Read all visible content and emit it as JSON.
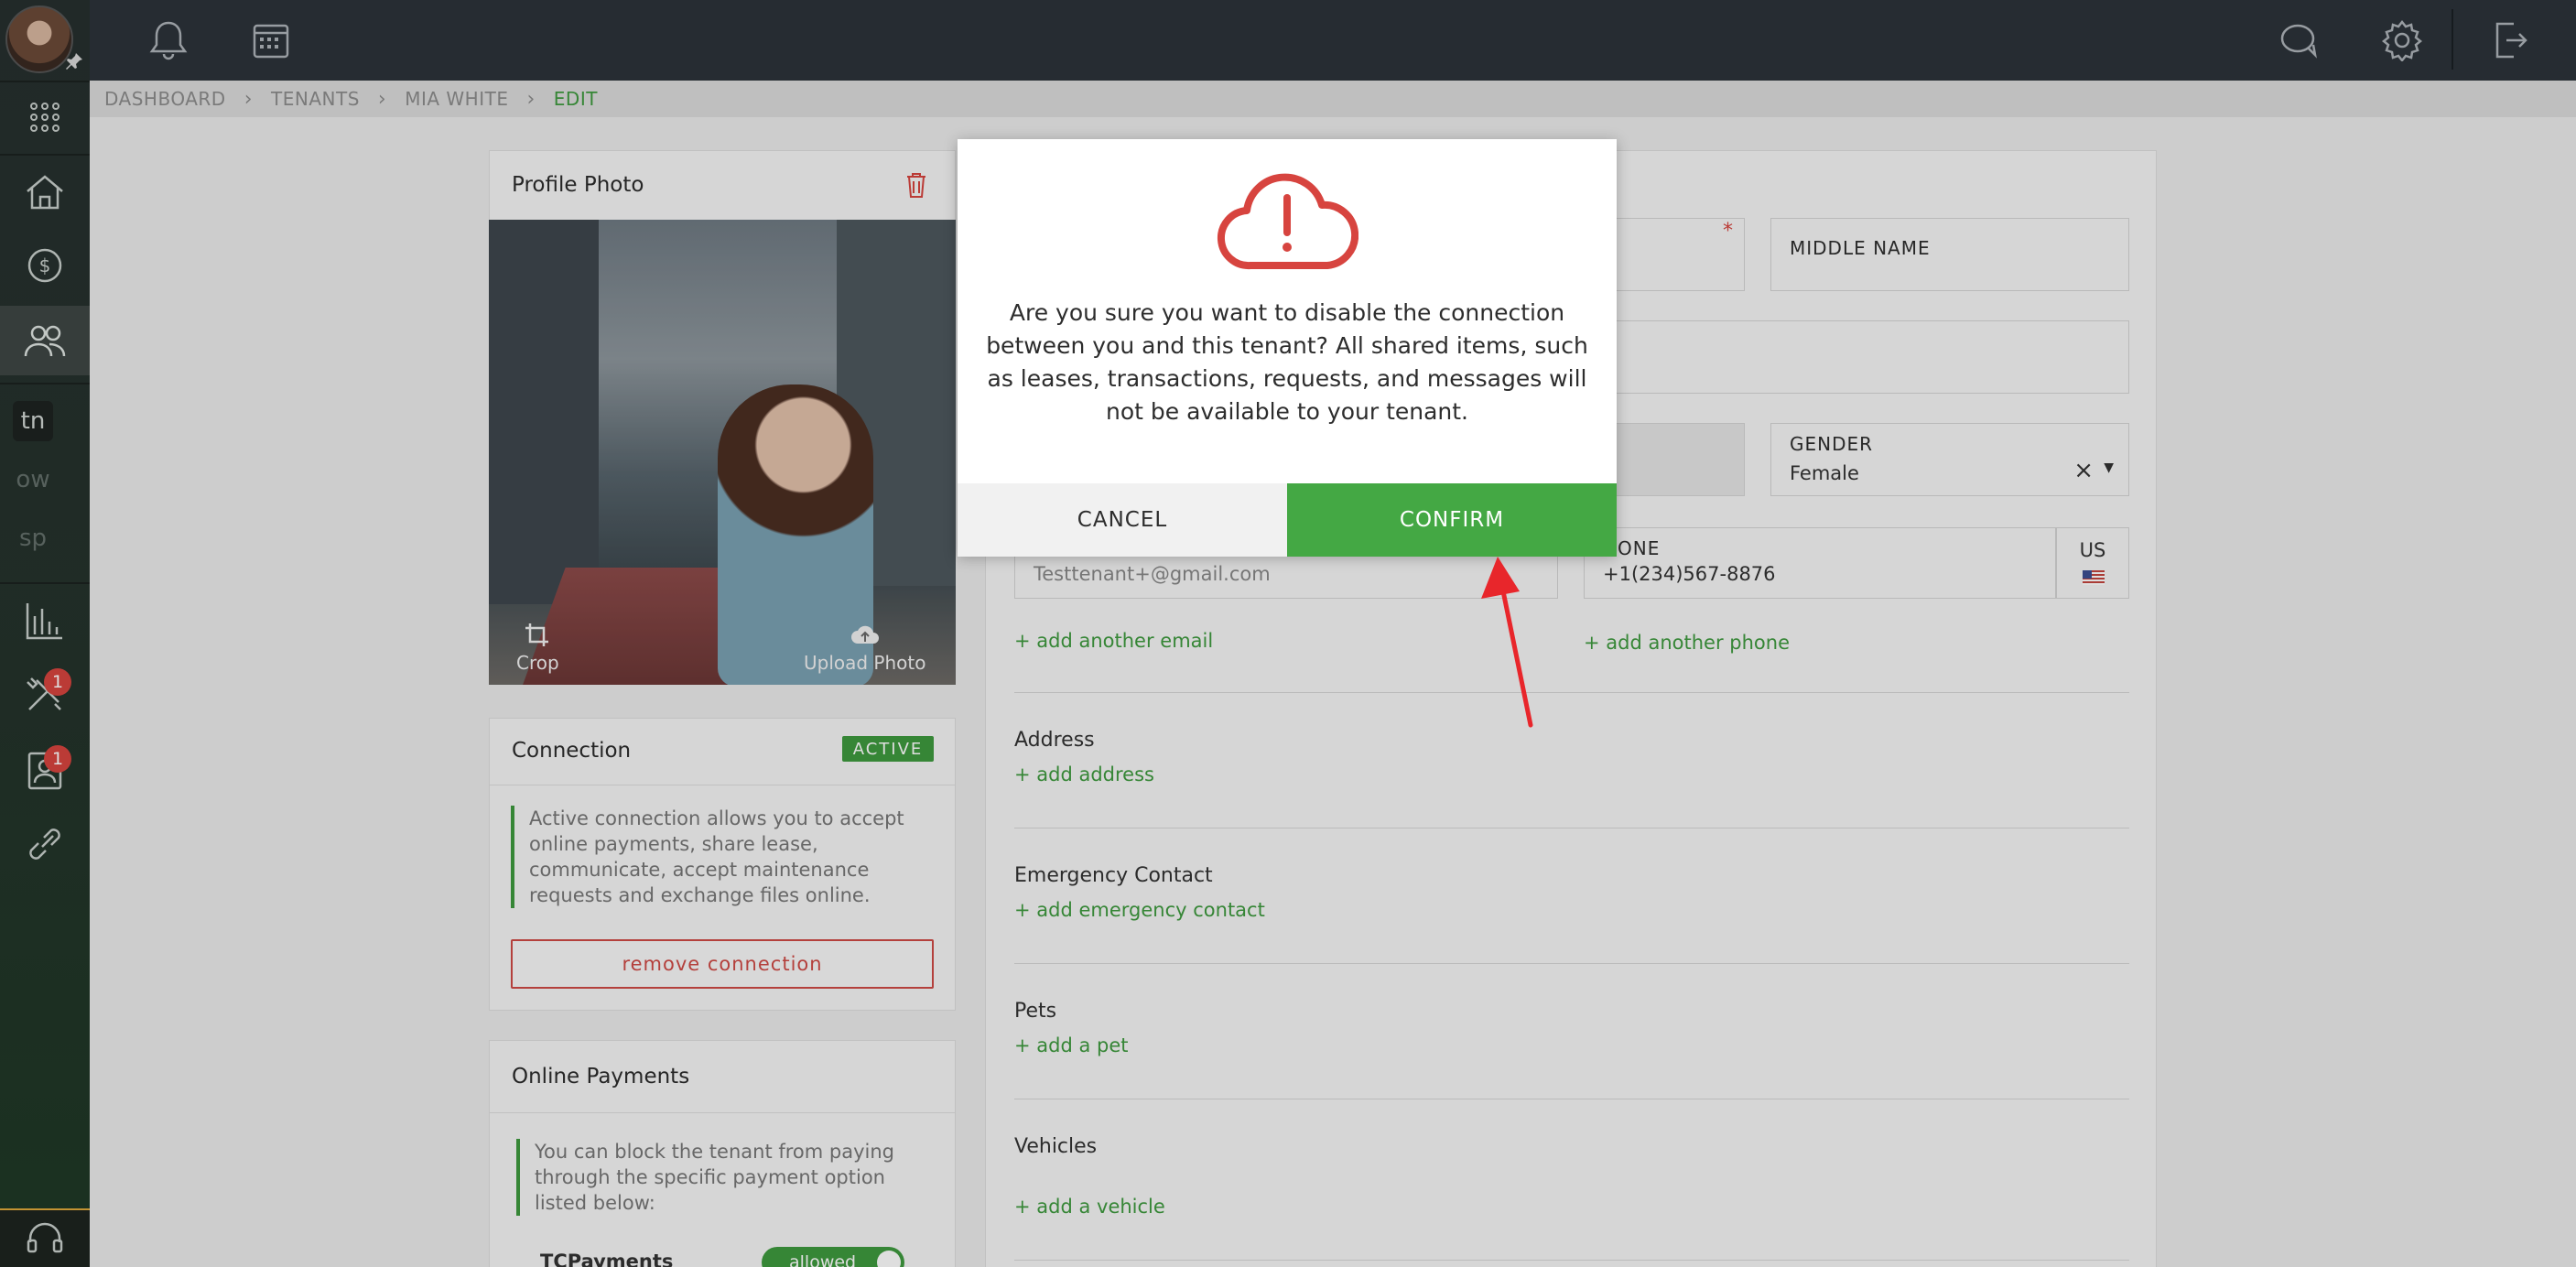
{
  "breadcrumb": {
    "items": [
      "DASHBOARD",
      "TENANTS",
      "MIA WHITE",
      "EDIT"
    ]
  },
  "sidebar": {
    "abbreviations": [
      "tn",
      "ow",
      "sp"
    ],
    "badges": {
      "maintenance": "1",
      "applications": "1"
    }
  },
  "profile_photo": {
    "title": "Profile Photo",
    "crop_label": "Crop",
    "upload_label": "Upload Photo"
  },
  "connection": {
    "title": "Connection",
    "status": "ACTIVE",
    "description": "Active connection allows you to accept online payments, share lease, communicate, accept maintenance requests and exchange files online.",
    "remove_label": "remove connection"
  },
  "online_payments": {
    "title": "Online Payments",
    "description": "You can block the tenant from paying through the specific payment option listed below:",
    "method": "TCPayments",
    "toggle_label": "allowed"
  },
  "form": {
    "middle_name_label": "MIDDLE NAME",
    "gender_label": "GENDER",
    "gender_value": "Female",
    "email_value": "Testtenant+@gmail.com",
    "phone_label": "PHONE",
    "phone_label_visible": "HONE",
    "phone_value": "+1(234)567-8876",
    "country_code": "US",
    "add_email": "+ add another email",
    "add_phone": "+ add another phone",
    "address_title": "Address",
    "add_address": "+ add address",
    "emergency_title": "Emergency Contact",
    "add_emergency": "+ add emergency contact",
    "pets_title": "Pets",
    "add_pet": "+ add a pet",
    "vehicles_title": "Vehicles",
    "add_vehicle": "+ add a vehicle"
  },
  "modal": {
    "message": "Are you sure you want to disable the connection between you and this tenant? All shared items, such as leases, transactions, requests, and messages will not be available to your tenant.",
    "cancel_label": "CANCEL",
    "confirm_label": "CONFIRM",
    "icon": "cloud-alert-icon",
    "accent_color": "#d7443f",
    "confirm_color": "#44a844"
  }
}
